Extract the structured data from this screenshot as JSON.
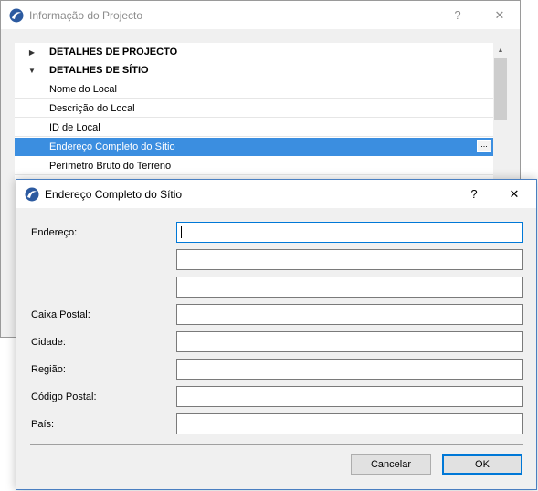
{
  "bg_window": {
    "title": "Informação do Projecto",
    "help_label": "?",
    "close_label": "✕",
    "tree": [
      {
        "label": "DETALHES DE PROJECTO",
        "type": "group",
        "expanded": false
      },
      {
        "label": "DETALHES DE SÍTIO",
        "type": "group",
        "expanded": true
      },
      {
        "label": "Nome do Local",
        "type": "item"
      },
      {
        "label": "Descrição do Local",
        "type": "item"
      },
      {
        "label": "ID de Local",
        "type": "item"
      },
      {
        "label": "Endereço Completo do Sítio",
        "type": "item",
        "selected": true,
        "button": "..."
      },
      {
        "label": "Perímetro Bruto do Terreno",
        "type": "item"
      }
    ]
  },
  "dialog": {
    "title": "Endereço Completo do Sítio",
    "help_label": "?",
    "close_label": "✕",
    "fields": [
      {
        "label": "Endereço:",
        "value": ""
      },
      {
        "label": "",
        "value": ""
      },
      {
        "label": "",
        "value": ""
      },
      {
        "label": "Caixa Postal:",
        "value": ""
      },
      {
        "label": "Cidade:",
        "value": ""
      },
      {
        "label": "Região:",
        "value": ""
      },
      {
        "label": "Código Postal:",
        "value": ""
      },
      {
        "label": "País:",
        "value": ""
      }
    ],
    "cancel_label": "Cancelar",
    "ok_label": "OK"
  },
  "colors": {
    "accent": "#0078d7",
    "selection": "#3b8ee0"
  },
  "icons": {
    "app": "archicad-logo-icon",
    "expand": "triangle-right-icon",
    "collapse": "triangle-down-icon"
  }
}
